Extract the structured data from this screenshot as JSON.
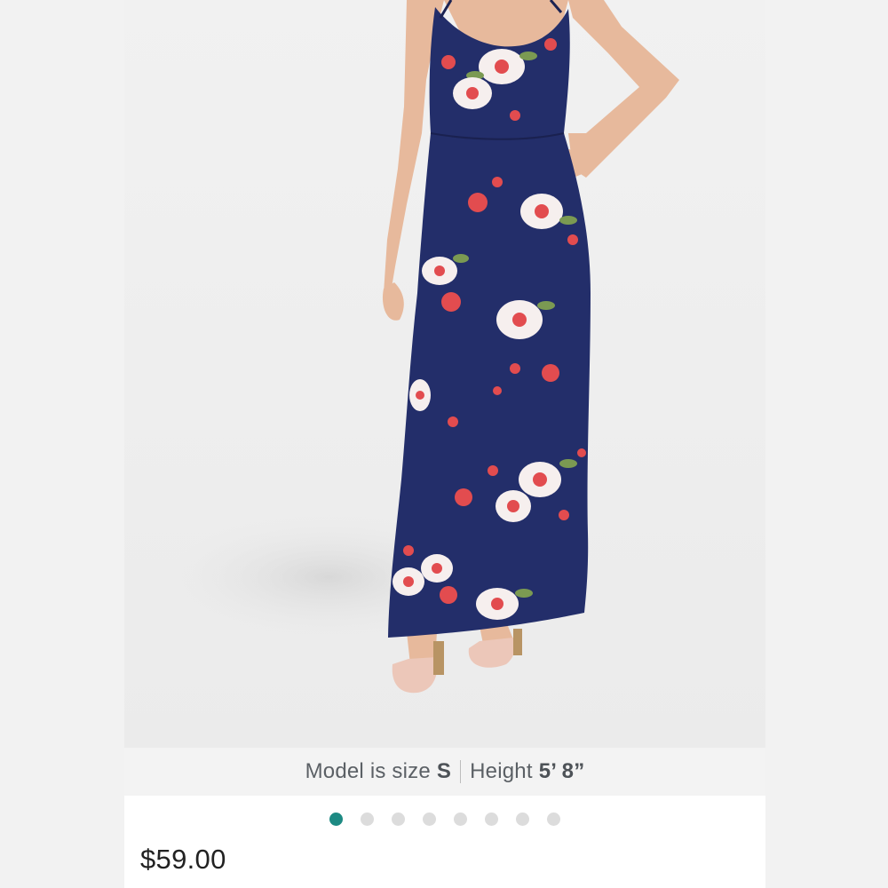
{
  "product": {
    "image_alt": "Navy floral maxi dress on model",
    "caption": {
      "prefix": "Model is size",
      "size": "S",
      "height_label": "Height",
      "height": "5’ 8”"
    },
    "carousel": {
      "total": 8,
      "active_index": 0
    },
    "price": "$59.00"
  },
  "colors": {
    "dress": "#232e6a",
    "accent": "#1d8a83",
    "flower_white": "#f6efee",
    "flower_red": "#e24c4f",
    "leaf": "#7b9a52"
  }
}
